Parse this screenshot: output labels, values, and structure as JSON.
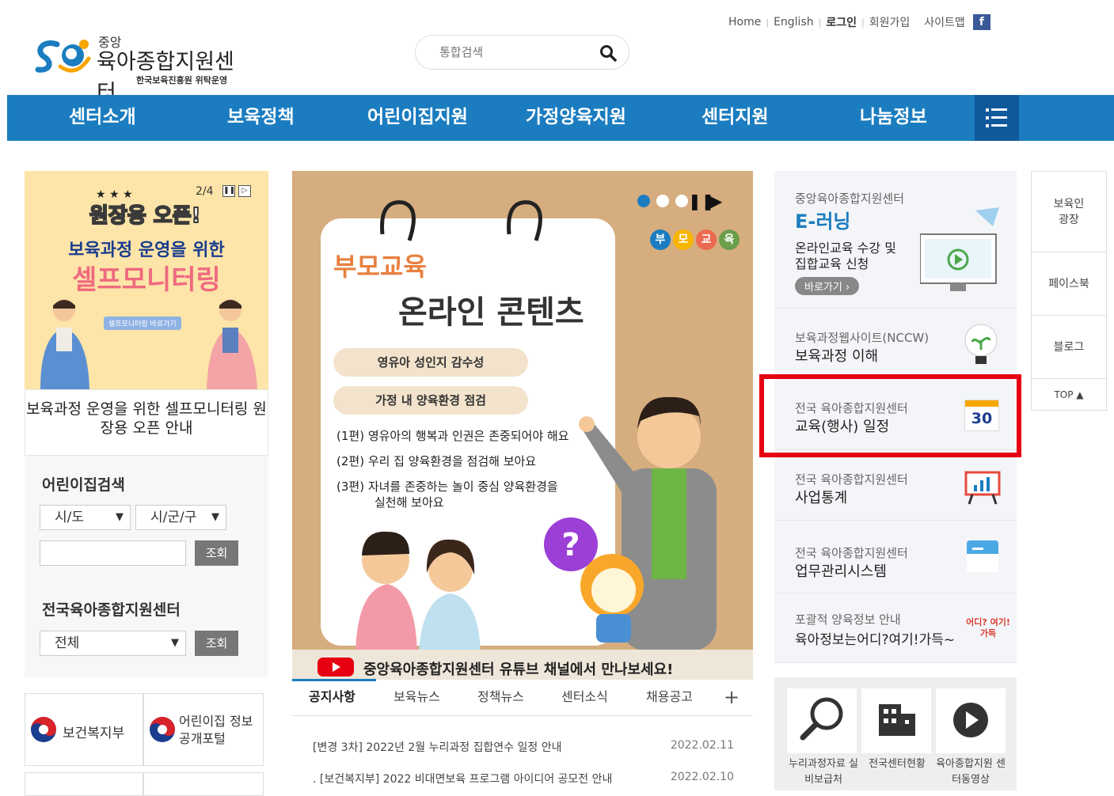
{
  "header": {
    "top_links": [
      "Home",
      "English",
      "로그인",
      "회원가입",
      "사이트맵"
    ],
    "facebook_label": "f",
    "logo": {
      "small": "중앙",
      "title": "육아종합지원센터",
      "sub": "한국보육진흥원 위탁운영"
    },
    "search_placeholder": "통합검색"
  },
  "nav": {
    "items": [
      "센터소개",
      "보육정책",
      "어린이집지원",
      "가정양육지원",
      "센터지원",
      "나눔정보"
    ]
  },
  "left_banner": {
    "counter": "2/4",
    "open_title": "원장용 오픈!",
    "line1": "보육과정 운영을 위한",
    "line2": "셀프모니터링",
    "button": "셀프모니터링 바로가기",
    "caption": "보육과정 운영을 위한 셀프모니터링 원장용 오픈 안내"
  },
  "daycare_search": {
    "title": "어린이집검색",
    "sido": "시/도",
    "sigungu": "시/군/구",
    "query_button": "조회"
  },
  "center_search": {
    "title": "전국육아종합지원센터",
    "select": "전체",
    "query_button": "조회"
  },
  "partner_links": [
    "보건복지부",
    "어린이집 정보공개포털"
  ],
  "main_banner": {
    "kicker": "부모교육",
    "title": "온라인 콘텐츠",
    "pill1": "영유아 성인지 감수성",
    "pill2": "가정 내 양육환경 점검",
    "ep1": "(1편) 영유아의 행복과 인권은 존중되어야 해요",
    "ep2": "(2편) 우리 집 양육환경을 점검해 보아요",
    "ep3a": "(3편) 자녀를 존중하는 놀이 중심  양육환경을",
    "ep3b": "실천해 보아요",
    "badge": [
      "부",
      "모",
      "교",
      "육"
    ],
    "youtube_text": "중앙육아종합지원센터 유튜브 채널에서 만나보세요!"
  },
  "tabs": [
    "공지사항",
    "보육뉴스",
    "정책뉴스",
    "센터소식",
    "채용공고"
  ],
  "plus": "+",
  "news": [
    {
      "title": "[변경 3차] 2022년 2월 누리과정 집합연수 일정 안내",
      "date": "2022.02.11"
    },
    {
      "title": ". [보건복지부] 2022 비대면보육 프로그램 아이디어 공모전 안내",
      "date": "2022.02.10"
    }
  ],
  "right": {
    "elearn": {
      "small": "중앙육아종합지원센터",
      "title": "E-러닝",
      "desc1": "온라인교육 수강 및",
      "desc2": "집합교육 신청",
      "go": "바로가기 ›"
    },
    "nccw": {
      "small": "보육과정웹사이트(NCCW)",
      "big": "보육과정 이해"
    },
    "schedule": {
      "small": "전국 육아종합지원센터",
      "big": "교육(행사) 일정",
      "cal": "30"
    },
    "stats": {
      "small": "전국 육아종합지원센터",
      "big": "사업통계"
    },
    "system": {
      "small": "전국 육아종합지원센터",
      "big": "업무관리시스템"
    },
    "info": {
      "small": "포괄적 양육정보 안내",
      "big": "육아정보는어디?여기!가득~",
      "img": "어디? 여기! 가득"
    }
  },
  "quick": [
    "누리과정자료 실비보급처",
    "전국센터현황",
    "육아종합지원 센터동영상"
  ],
  "rail": [
    "보육인 광장",
    "페이스북",
    "블로그",
    "TOP ▲"
  ],
  "colors": {
    "nav": "#1b7dc0",
    "nav_dark": "#10599b",
    "highlight": "#e60012"
  }
}
